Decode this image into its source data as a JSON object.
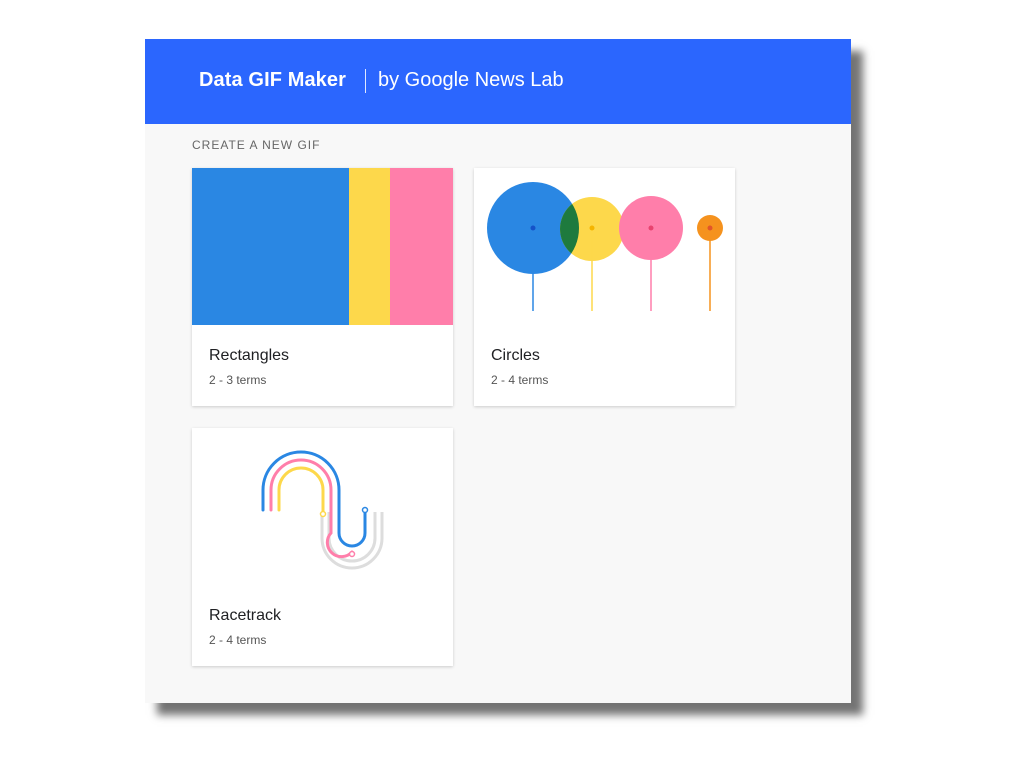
{
  "header": {
    "title": "Data GIF Maker",
    "byline": "by Google News Lab",
    "color": "#2b66fe"
  },
  "section": {
    "label": "CREATE A NEW GIF"
  },
  "cards": [
    {
      "title": "Rectangles",
      "subtitle": "2 - 3 terms",
      "icon": "rectangles-preview"
    },
    {
      "title": "Circles",
      "subtitle": "2 - 4 terms",
      "icon": "circles-preview"
    },
    {
      "title": "Racetrack",
      "subtitle": "2 - 4 terms",
      "icon": "racetrack-preview"
    }
  ],
  "palette": {
    "blue": "#2a87e3",
    "yellow": "#fdd84b",
    "pink": "#ff7eaa",
    "orange": "#f5921e",
    "overlap": "#1e7a3e",
    "gray": "#dddddd"
  }
}
